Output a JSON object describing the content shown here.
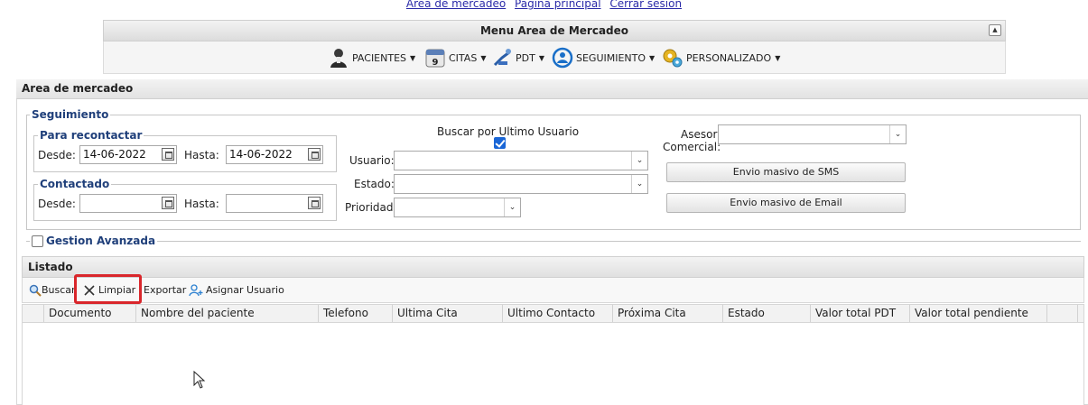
{
  "top_links": [
    "Area de mercadeo",
    "Página principal",
    "Cerrar sesión"
  ],
  "menu": {
    "title": "Menu Area de Mercadeo",
    "items": [
      {
        "label": "PACIENTES",
        "icon": "patient-icon"
      },
      {
        "label": "CITAS",
        "icon": "calendar-icon"
      },
      {
        "label": "PDT",
        "icon": "dental-chair-icon"
      },
      {
        "label": "SEGUIMIENTO",
        "icon": "followup-icon"
      },
      {
        "label": "PERSONALIZADO",
        "icon": "gears-icon"
      }
    ]
  },
  "panel_title": "Area de mercadeo",
  "seguimiento": {
    "legend": "Seguimiento",
    "para_recontactar": {
      "legend": "Para recontactar",
      "desde_label": "Desde:",
      "desde_value": "14-06-2022",
      "hasta_label": "Hasta:",
      "hasta_value": "14-06-2022"
    },
    "contactado": {
      "legend": "Contactado",
      "desde_label": "Desde:",
      "desde_value": "",
      "hasta_label": "Hasta:",
      "hasta_value": ""
    },
    "buscar_ultimo_usuario_label": "Buscar por Ultimo Usuario",
    "buscar_ultimo_usuario_checked": true,
    "usuario_label": "Usuario:",
    "usuario_value": "",
    "estado_label": "Estado:",
    "estado_value": "",
    "prioridad_label": "Prioridad:",
    "prioridad_value": "",
    "asesor_label_1": "Asesor",
    "asesor_label_2": "Comercial:",
    "asesor_value": "",
    "sms_button": "Envio masivo de SMS",
    "email_button": "Envio masivo de Email"
  },
  "gestion_avanzada": {
    "label": "Gestion Avanzada",
    "checked": false
  },
  "listado": {
    "title": "Listado",
    "toolbar": {
      "buscar": "Buscar",
      "limpiar": "Limpiar",
      "exportar": "Exportar",
      "asignar": "Asignar Usuario"
    },
    "columns": [
      "Documento",
      "Nombre del paciente",
      "Telefono",
      "Ultima Cita",
      "Ultimo Contacto",
      "Próxima Cita",
      "Estado",
      "Valor total PDT",
      "Valor total pendiente"
    ],
    "rows": []
  },
  "colors": {
    "accent_highlight": "#d9262b",
    "legend_text": "#1f3f7a",
    "checkbox_blue": "#1a66d6",
    "link": "#2a2aa8"
  }
}
